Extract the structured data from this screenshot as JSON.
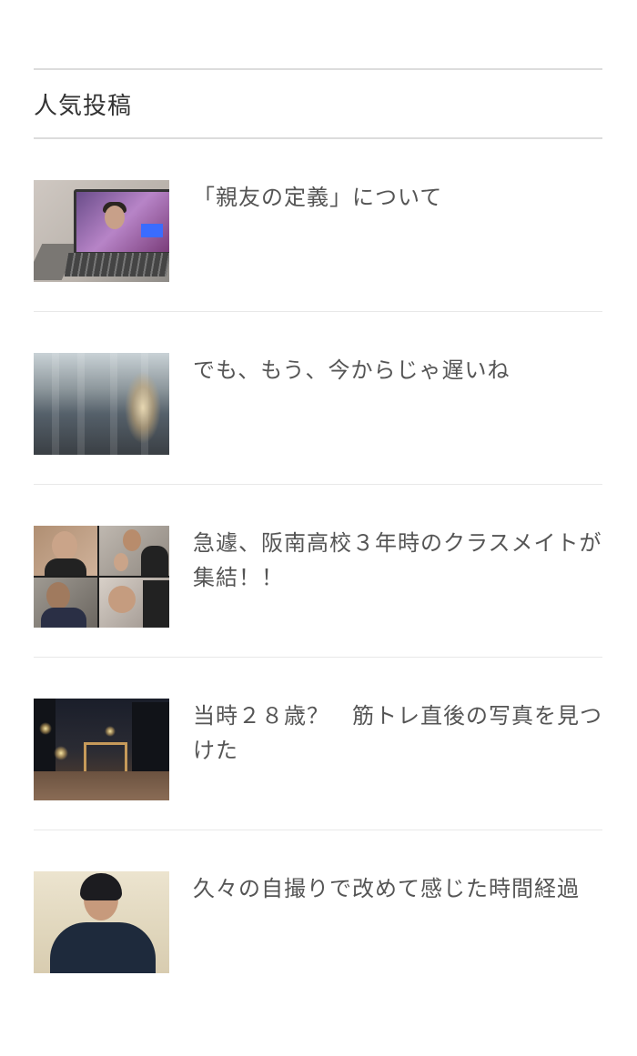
{
  "widget": {
    "title": "人気投稿"
  },
  "posts": [
    {
      "title": "「親友の定義」について"
    },
    {
      "title": "でも、もう、今からじゃ遅いね"
    },
    {
      "title": "急遽、阪南高校３年時のクラスメイトが集結！！"
    },
    {
      "title": "当時２８歳？　筋トレ直後の写真を見つけた"
    },
    {
      "title": "久々の自撮りで改めて感じた時間経過"
    }
  ]
}
